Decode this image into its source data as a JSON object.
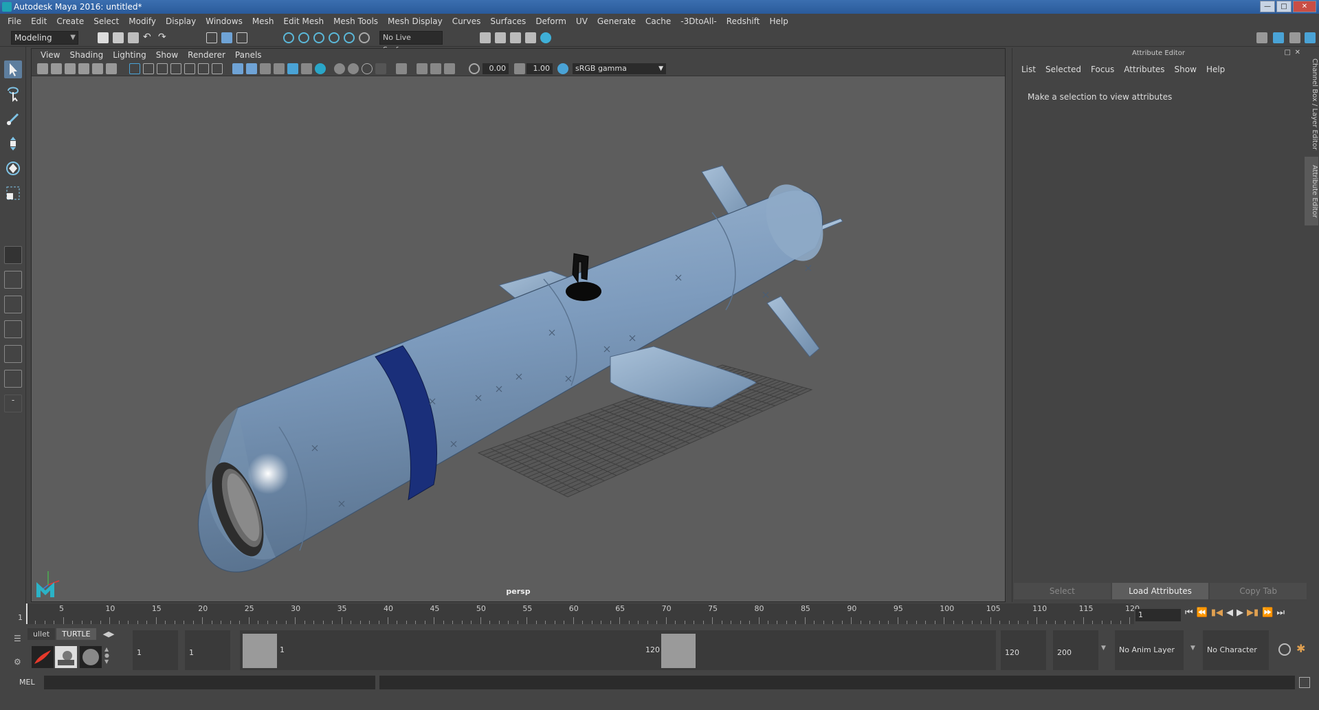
{
  "window": {
    "title": "Autodesk Maya 2016: untitled*"
  },
  "menubar": [
    "File",
    "Edit",
    "Create",
    "Select",
    "Modify",
    "Display",
    "Windows",
    "Mesh",
    "Edit Mesh",
    "Mesh Tools",
    "Mesh Display",
    "Curves",
    "Surfaces",
    "Deform",
    "UV",
    "Generate",
    "Cache",
    "-3DtoAll-",
    "Redshift",
    "Help"
  ],
  "statusline": {
    "mode": "Modeling",
    "live_surface": "No Live Surface"
  },
  "viewport": {
    "menu": [
      "View",
      "Shading",
      "Lighting",
      "Show",
      "Renderer",
      "Panels"
    ],
    "exposure": "0.00",
    "gamma_value": "1.00",
    "color_space": "sRGB gamma",
    "camera_label": "persp"
  },
  "attribute_editor": {
    "title": "Attribute Editor",
    "menu": [
      "List",
      "Selected",
      "Focus",
      "Attributes",
      "Show",
      "Help"
    ],
    "message": "Make a selection to view attributes",
    "buttons": [
      "Select",
      "Load Attributes",
      "Copy Tab"
    ]
  },
  "side_tabs": {
    "channel_box": "Channel Box / Layer Editor",
    "attribute_editor": "Attribute Editor"
  },
  "timeline": {
    "ticks": [
      "5",
      "10",
      "15",
      "20",
      "25",
      "30",
      "35",
      "40",
      "45",
      "50",
      "55",
      "60",
      "65",
      "70",
      "75",
      "80",
      "85",
      "90",
      "95",
      "100",
      "105",
      "110",
      "115",
      "120"
    ],
    "start_label": "1",
    "current_frame": "1"
  },
  "range": {
    "start_frame": "1",
    "playback_start": "1",
    "range_start_label": "1",
    "range_end_label": "120",
    "playback_end": "120",
    "end_frame": "200"
  },
  "shelf": {
    "tabs": [
      "ullet",
      "TURTLE"
    ]
  },
  "layers": {
    "anim_layer": "No Anim Layer",
    "character_set": "No Character Set"
  },
  "command_line": {
    "label": "MEL"
  },
  "colors": {
    "viewport_bg": "#5d5d5d",
    "missile_body": "#7d9bbd",
    "missile_band": "#1a2f7a",
    "ui_panel": "#444444"
  }
}
